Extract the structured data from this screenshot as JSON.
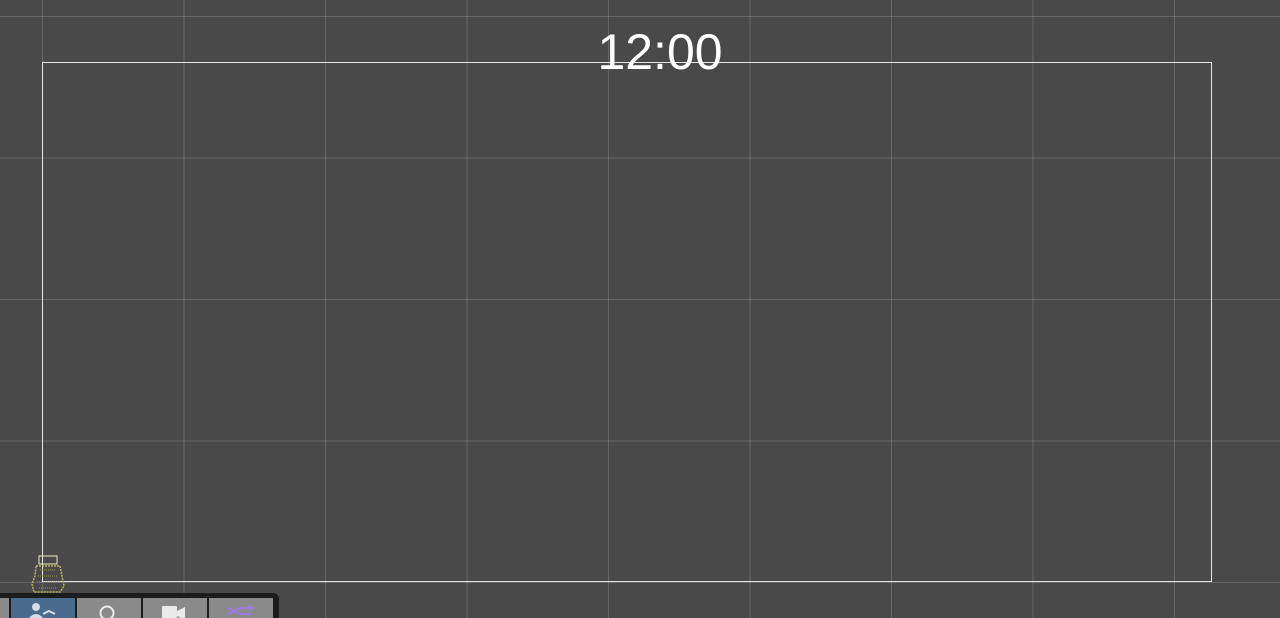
{
  "stage": {
    "clock_text": "12:00"
  },
  "toolbar": {
    "tools": [
      {
        "icon": "sprite-tool-icon",
        "active": true
      },
      {
        "icon": "search-icon",
        "active": false
      },
      {
        "icon": "camera-icon",
        "active": false
      },
      {
        "icon": "shuffle-icon",
        "active": false
      }
    ]
  },
  "colors": {
    "background": "#494949",
    "grid_line": "#6a6a6a",
    "frame_border": "#e6e6e6",
    "toolbar_bg": "#1c1c1c",
    "tool_bg": "#8a8a8a",
    "tool_active_bg": "#4a6a8e",
    "shuffle_icon": "#9b7be0",
    "sprite": "#b8b45a"
  }
}
